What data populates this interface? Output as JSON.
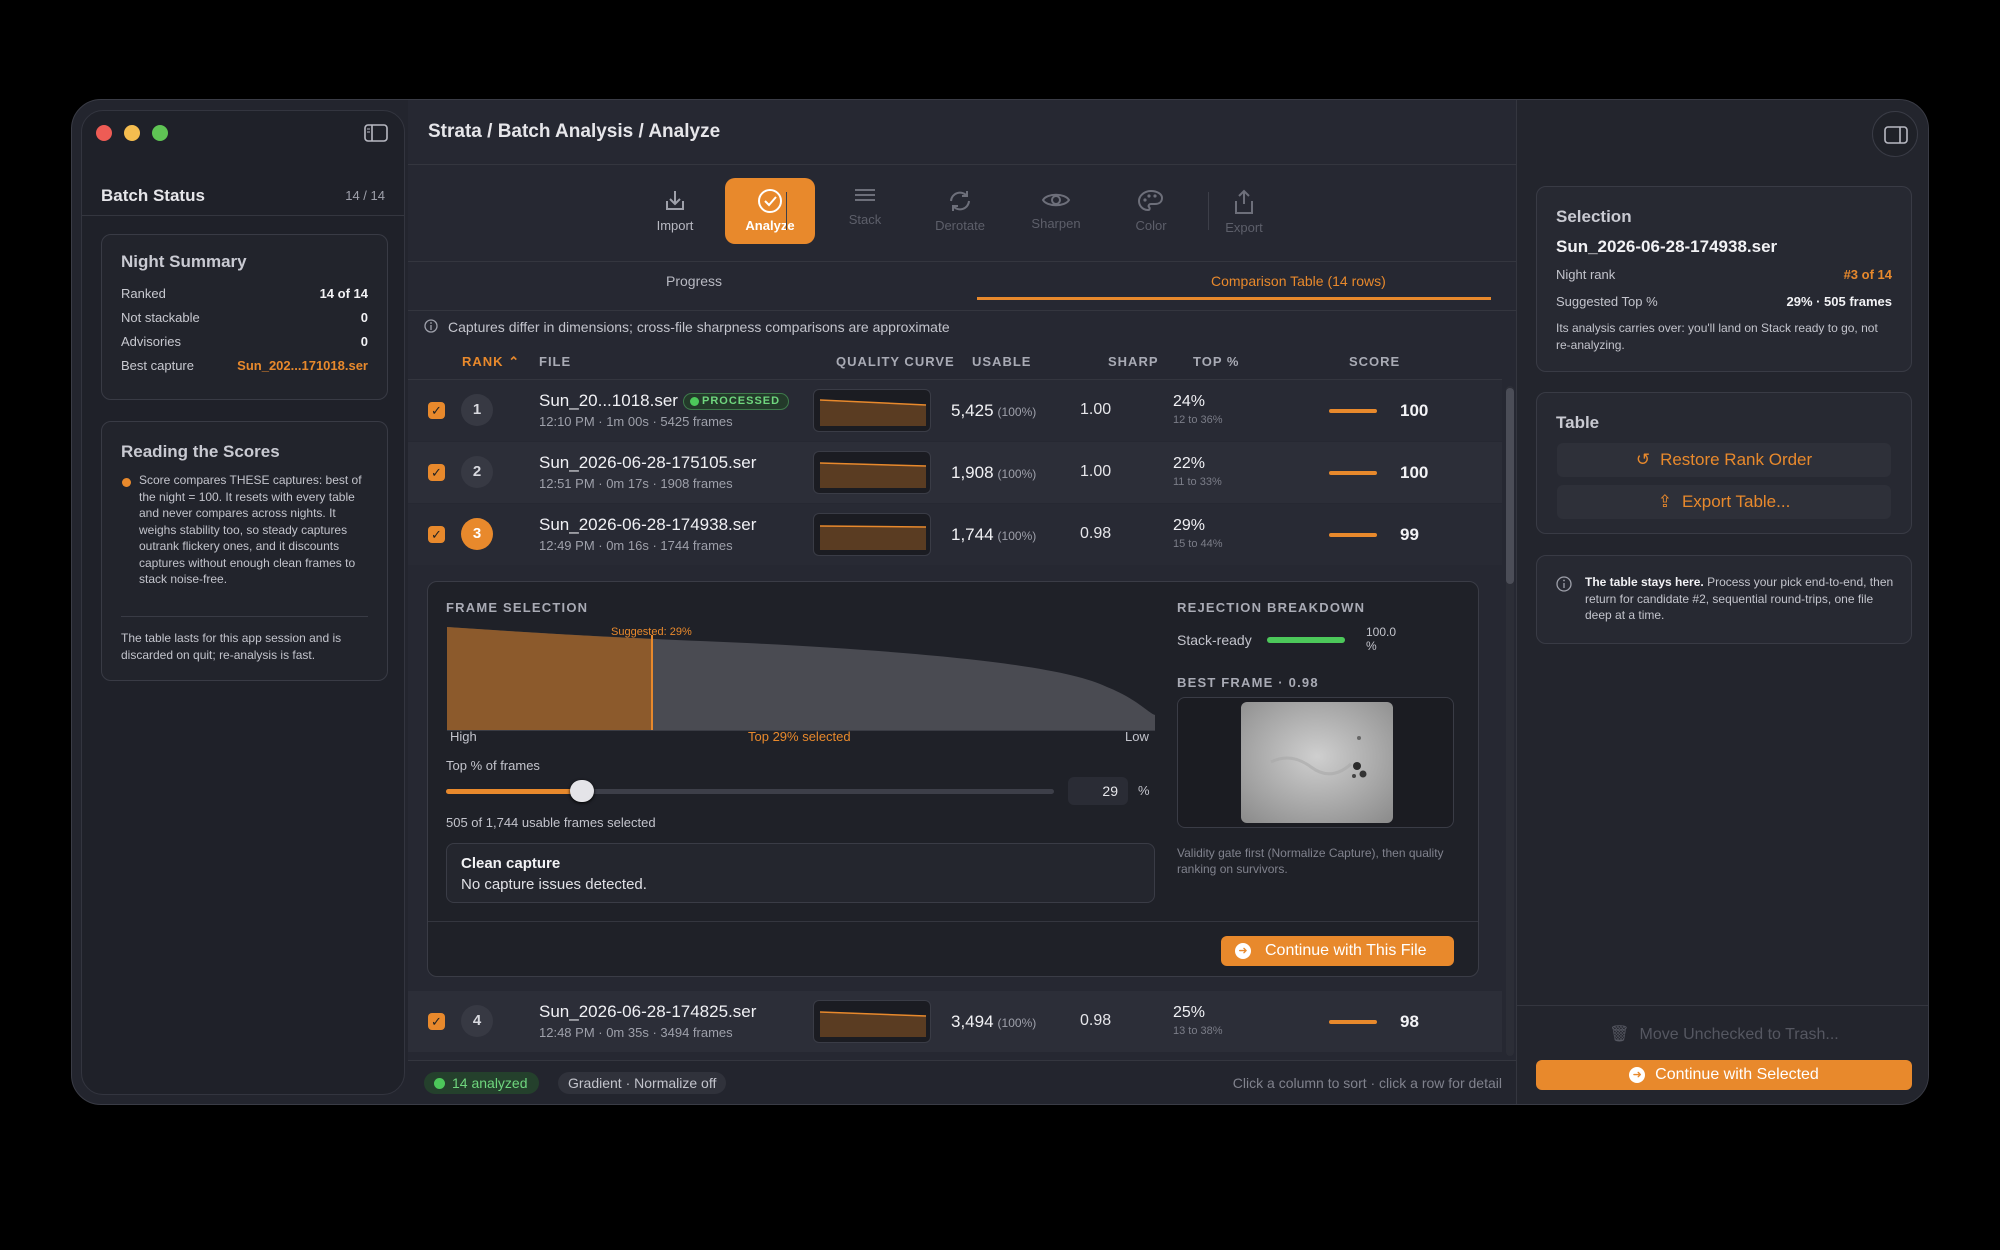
{
  "breadcrumb": "Strata / Batch Analysis / Analyze",
  "sidebar": {
    "title": "Batch Status",
    "count": "14 / 14",
    "night_summary": {
      "title": "Night Summary",
      "rows": [
        {
          "label": "Ranked",
          "value": "14 of 14"
        },
        {
          "label": "Not stackable",
          "value": "0"
        },
        {
          "label": "Advisories",
          "value": "0"
        },
        {
          "label": "Best capture",
          "value": "Sun_202...171018.ser"
        }
      ]
    },
    "reading": {
      "title": "Reading the Scores",
      "body": "Score compares THESE captures: best of the night = 100. It resets with every table and never compares across nights. It weighs stability too, so steady captures outrank flickery ones, and it discounts captures without enough clean frames to stack noise-free.",
      "footer": "The table lasts for this app session and is discarded on quit; re-analysis is fast."
    }
  },
  "toolbar": {
    "items": [
      "Import",
      "Analyze",
      "Stack",
      "Derotate",
      "Sharpen",
      "Color",
      "Export"
    ]
  },
  "tabs": {
    "progress": "Progress",
    "comparison": "Comparison Table (14 rows)"
  },
  "notice": "Captures differ in dimensions; cross-file sharpness comparisons are approximate",
  "columns": {
    "rank": "RANK",
    "file": "FILE",
    "quality": "QUALITY CURVE",
    "usable": "USABLE",
    "sharp": "SHARP",
    "top": "TOP %",
    "score": "SCORE"
  },
  "rows": [
    {
      "rank": "1",
      "file": "Sun_20...1018.ser",
      "badge": "PROCESSED",
      "meta": "12:10 PM · 1m 00s · 5425 frames",
      "usable": "5,425",
      "usable_pct": "(100%)",
      "sharp": "1.00",
      "top": "24%",
      "top_range": "12 to 36%",
      "score": "100"
    },
    {
      "rank": "2",
      "file": "Sun_2026-06-28-175105.ser",
      "meta": "12:51 PM · 0m 17s · 1908 frames",
      "usable": "1,908",
      "usable_pct": "(100%)",
      "sharp": "1.00",
      "top": "22%",
      "top_range": "11 to 33%",
      "score": "100"
    },
    {
      "rank": "3",
      "file": "Sun_2026-06-28-174938.ser",
      "meta": "12:49 PM · 0m 16s · 1744 frames",
      "usable": "1,744",
      "usable_pct": "(100%)",
      "sharp": "0.98",
      "top": "29%",
      "top_range": "15 to 44%",
      "score": "99"
    },
    {
      "rank": "4",
      "file": "Sun_2026-06-28-174825.ser",
      "meta": "12:48 PM · 0m 35s · 3494 frames",
      "usable": "3,494",
      "usable_pct": "(100%)",
      "sharp": "0.98",
      "top": "25%",
      "top_range": "13 to 38%",
      "score": "98"
    }
  ],
  "detail": {
    "frame_selection": "FRAME SELECTION",
    "suggested": "Suggested: 29%",
    "high": "High",
    "low": "Low",
    "top_selected": "Top 29% selected",
    "slider_label": "Top % of frames",
    "slider_value": "29",
    "slider_fraction": 0.29,
    "pct": "%",
    "frames_selected": "505 of 1,744 usable frames selected",
    "clean_title": "Clean capture",
    "clean_body": "No capture issues detected.",
    "rejection": "REJECTION BREAKDOWN",
    "stack_ready": "Stack-ready",
    "stack_value": "100.0 %",
    "stack_fraction": 1.0,
    "best_frame": "BEST FRAME · 0.98",
    "validity": "Validity gate first (Normalize Capture), then quality ranking on survivors.",
    "continue": "Continue with This File"
  },
  "status": {
    "analyzed": "14 analyzed",
    "mode": "Gradient · Normalize off",
    "hint": "Click a column to sort · click a row for detail"
  },
  "inspector": {
    "sel_title": "Selection",
    "sel_file": "Sun_2026-06-28-174938.ser",
    "night_rank_label": "Night rank",
    "night_rank": "#3 of 14",
    "suggested_label": "Suggested Top %",
    "suggested": "29% · 505 frames",
    "carry": "Its analysis carries over: you'll land on Stack ready to go, not re-analyzing.",
    "table_title": "Table",
    "restore": "Restore Rank Order",
    "export": "Export Table...",
    "note_bold": "The table stays here.",
    "note": "Process your pick end-to-end, then return for candidate #2, sequential round-trips, one file deep at a time.",
    "trash": "Move Unchecked to Trash...",
    "continue_selected": "Continue with Selected"
  },
  "colors": {
    "accent": "#e8892c",
    "green": "#4cc85a"
  }
}
